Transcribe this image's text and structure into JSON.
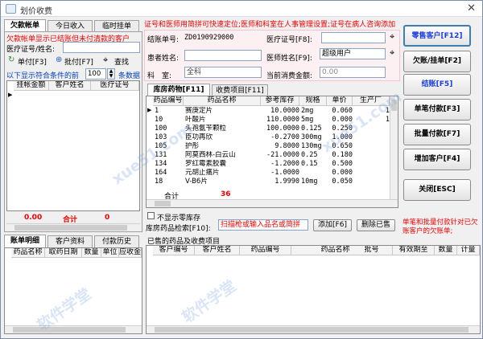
{
  "window": {
    "title": "划价收费"
  },
  "left_tabs": [
    "欠款帐单",
    "今日收入",
    "临时挂单"
  ],
  "left_notice": "欠款帐单显示已结账但未付清款的客户",
  "cert_label": "医疗证号/姓名:",
  "btn_single": "单付[F3]",
  "btn_batch": "批付[F7]",
  "btn_search": "查找",
  "filter_pre": "以下显示符合条件的前",
  "filter_value": "100",
  "filter_post": "条数据",
  "arrears_headers": [
    "挂帐金额",
    "客户姓名",
    "医疗证号"
  ],
  "arrears_totals": {
    "amount": "0.00",
    "label": "合计",
    "count": "0"
  },
  "bottom_left_tabs": [
    "账单明细",
    "客户资料",
    "付款历史"
  ],
  "detail_headers": [
    "药品名称",
    "取药日期",
    "数量",
    "单位",
    "应收金"
  ],
  "top_banner": "证号和医师用简拼可快速定位;医师和科室在人事管理设置;证号在病人咨询添加",
  "form": {
    "bill_label": "结账单号:",
    "bill_value": "ZD0190929000",
    "cert_label": "医疗证号[F8]:",
    "cert_value": "",
    "patient_label": "患者姓名:",
    "patient_value": "",
    "doctor_label": "医师姓名[F9]:",
    "doctor_value": "超级用户",
    "dept_label": "科　室:",
    "dept_value": "全科",
    "consume_label": "当前消费金额:",
    "consume_value": "0.00"
  },
  "mid_tabs": [
    "库房药物[F11]",
    "收费项目[F11]"
  ],
  "drug_headers": [
    "药品编号",
    "药品名称",
    "参考库存",
    "规格",
    "单价",
    "生产厂"
  ],
  "drug_rows": [
    [
      "1",
      "赛庚定片",
      "10.0000",
      "2mg",
      "0.060",
      "1"
    ],
    [
      "10",
      "叶酸片",
      "110.0000",
      "5mg",
      "0.000",
      "1"
    ],
    [
      "100",
      "头孢氨苄颗粒",
      "100.0000",
      "0.125",
      "0.250",
      ""
    ],
    [
      "103",
      "臣功再欣",
      "-0.2700",
      "300mg",
      "1.000",
      ""
    ],
    [
      "105",
      "护彤",
      "9.8000",
      "130mg",
      "0.650",
      ""
    ],
    [
      "131",
      "阿莫西林-白云山",
      "-21.0000",
      "0.25",
      "0.180",
      ""
    ],
    [
      "134",
      "罗红霉素胶囊",
      "-1.2000",
      "0.15",
      "0.500",
      ""
    ],
    [
      "164",
      "元胡止痛片",
      "-1.0000",
      "",
      "0.000",
      ""
    ],
    [
      "18",
      "V-B6片",
      "1.9990",
      "10mg",
      "0.050",
      ""
    ]
  ],
  "drug_total_label": "合计",
  "drug_total_value": "36",
  "zero_stock_label": "不显示零库存",
  "search_label": "库房药品检索[F10]:",
  "search_placeholder": "扫描枪或输入品名或简拼",
  "btn_add": "添加[F6]",
  "btn_delete": "删除已售",
  "sold_title": "已售的药品及收费项目",
  "sold_headers": [
    "客户编号",
    "客户姓名",
    "药品编号",
    "药品名称",
    "批号",
    "有效期至",
    "数量",
    "计量"
  ],
  "right_buttons": [
    "零售客户[F12]",
    "欠账/挂单[F2]",
    "结账[F5]",
    "单笔付款[F3]",
    "批量付款[F7]",
    "增加客户[F4]",
    "关闭[ESC]"
  ],
  "right_note": "单笔和批量付款针对已欠账客户的欠账单;",
  "watermark": "xue51.com",
  "watermark_cn": "软件学堂"
}
